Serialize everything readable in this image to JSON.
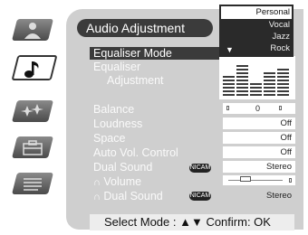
{
  "title": "Audio Adjustment",
  "menu": {
    "equaliser_mode": "Equaliser Mode",
    "equaliser_line1": "Equaliser",
    "equaliser_line2": "Adjustment",
    "balance": "Balance",
    "loudness": "Loudness",
    "space": "Space",
    "auto_vol": "Auto Vol. Control",
    "dual_sound": "Dual Sound",
    "headphone_volume": "Volume",
    "headphone_dual_sound": "Dual Sound"
  },
  "values": {
    "balance": "0",
    "loudness": "Off",
    "space": "Off",
    "auto_vol": "Off",
    "dual_sound": "Stereo",
    "headphone_dual_sound": "Stereo",
    "volume_level": 0.25
  },
  "badge": "NICAM",
  "dropdown": {
    "options": [
      "Personal",
      "Vocal",
      "Jazz",
      "Rock"
    ],
    "selected": "Personal"
  },
  "footer": {
    "text": "Select Mode : ▲▼   Confirm: OK"
  },
  "tabs": [
    {
      "name": "picture",
      "icon": "person-icon"
    },
    {
      "name": "audio",
      "icon": "music-note-icon",
      "active": true
    },
    {
      "name": "features",
      "icon": "sparkle-icon"
    },
    {
      "name": "installation",
      "icon": "toolbox-icon"
    },
    {
      "name": "teletext",
      "icon": "document-icon"
    }
  ],
  "colors": {
    "panel": "#cfcfcf",
    "highlight": "#3b3b3b"
  }
}
